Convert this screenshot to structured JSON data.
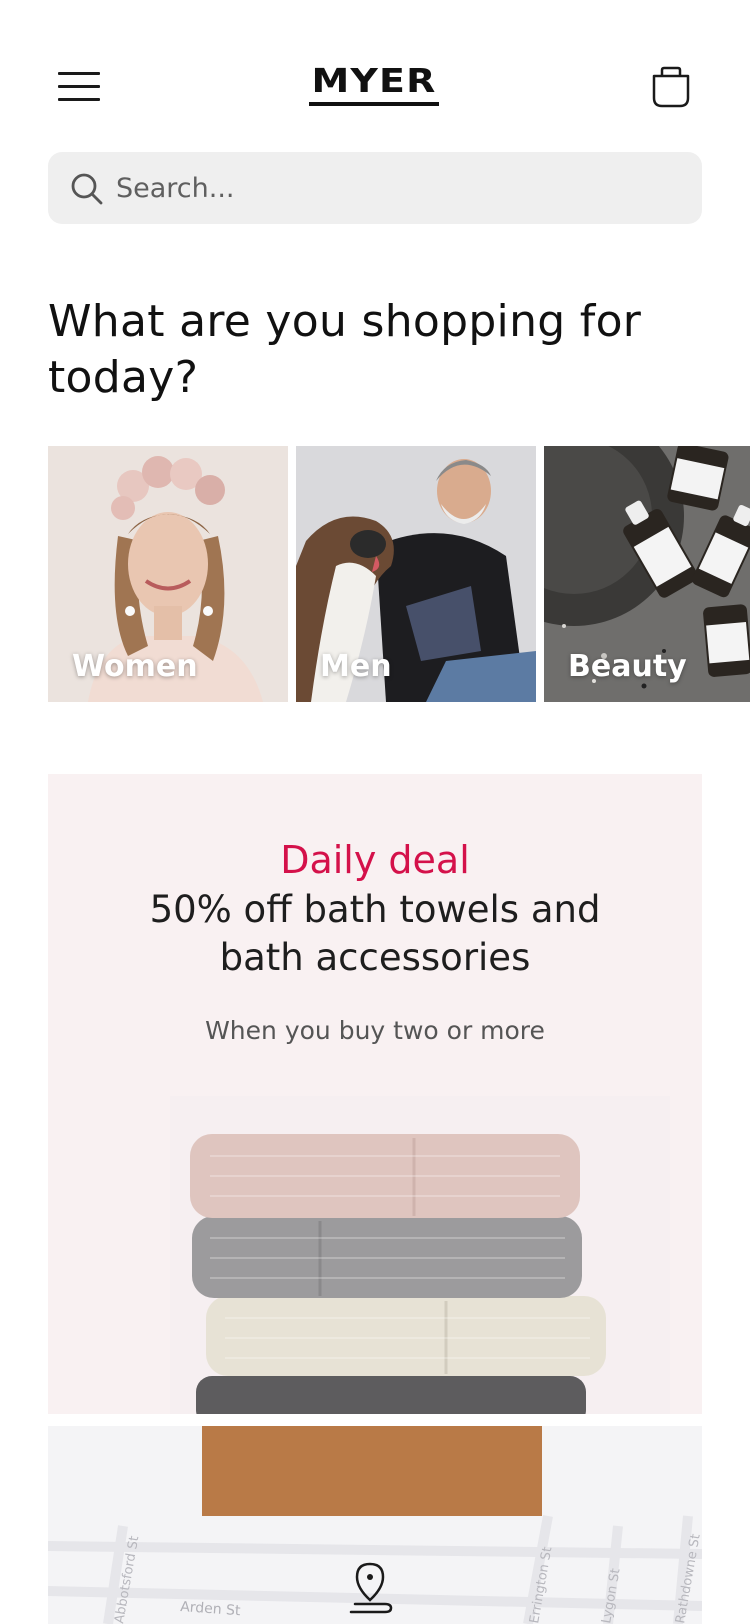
{
  "header": {
    "logo_text": "MYER",
    "menu_icon": "hamburger-menu-icon",
    "bag_icon": "shopping-bag-icon"
  },
  "search": {
    "placeholder": "Search...",
    "icon": "search-icon"
  },
  "heading": "What are you shopping for today?",
  "categories": [
    {
      "label": "Women"
    },
    {
      "label": "Men"
    },
    {
      "label": "Beauty"
    }
  ],
  "deal": {
    "kicker": "Daily deal",
    "title": "50% off bath towels and bath accessories",
    "subtitle": "When you buy two or more"
  },
  "store_map": {
    "streets": [
      "Arden St",
      "Abbotsford St",
      "Errington St",
      "Lygon St",
      "Rathdowne St"
    ],
    "pin_icon": "location-pin-icon"
  },
  "colors": {
    "accent": "#d4114a",
    "deal_background": "#f9f1f2",
    "search_background": "#efefef"
  }
}
